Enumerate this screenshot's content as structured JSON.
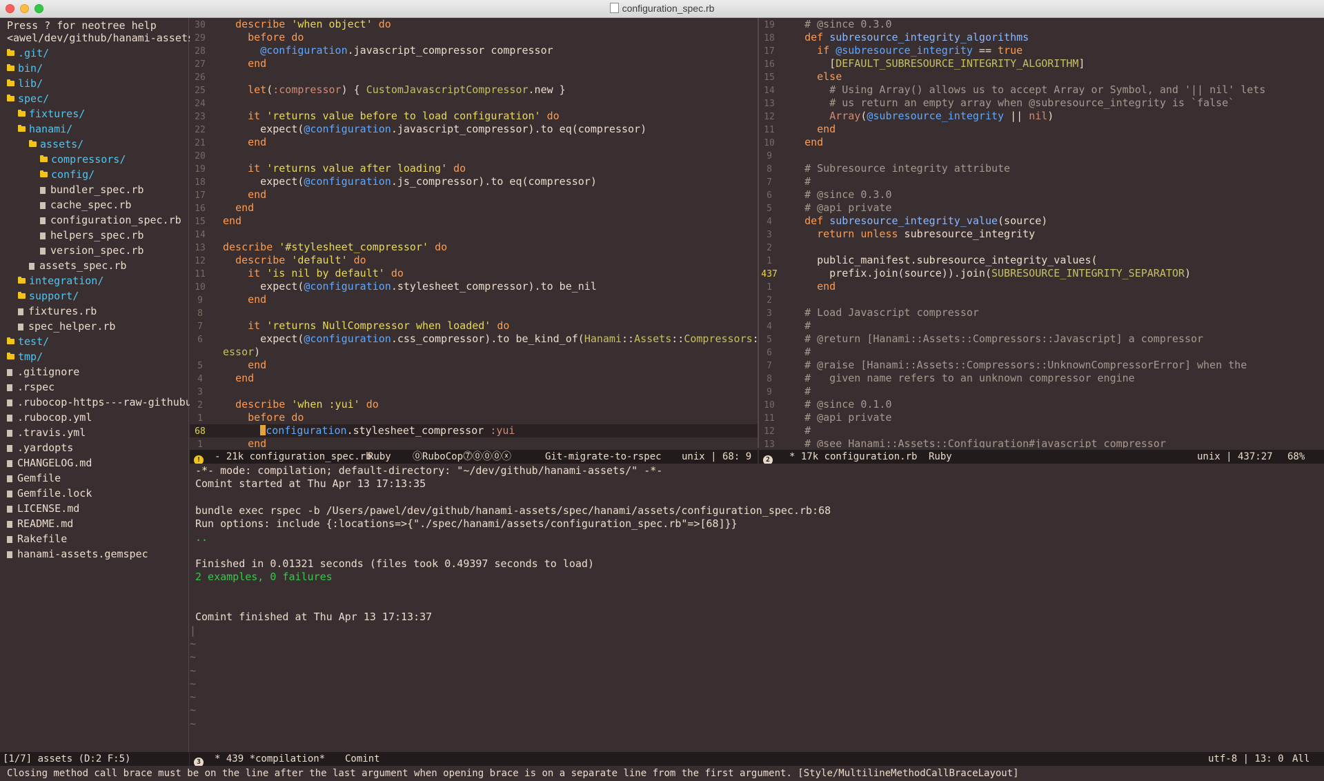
{
  "window": {
    "title": "configuration_spec.rb"
  },
  "tree": {
    "help": "Press ? for neotree help",
    "path": "<awel/dev/github/hanami-assets/",
    "items": [
      {
        "label": ".git/",
        "kind": "dir",
        "depth": 0
      },
      {
        "label": "bin/",
        "kind": "dir",
        "depth": 0
      },
      {
        "label": "lib/",
        "kind": "dir",
        "depth": 0
      },
      {
        "label": "spec/",
        "kind": "dir",
        "depth": 0
      },
      {
        "label": "fixtures/",
        "kind": "dir",
        "depth": 1
      },
      {
        "label": "hanami/",
        "kind": "dir",
        "depth": 1
      },
      {
        "label": "assets/",
        "kind": "dir",
        "depth": 2
      },
      {
        "label": "compressors/",
        "kind": "dir",
        "depth": 3
      },
      {
        "label": "config/",
        "kind": "dir",
        "depth": 3
      },
      {
        "label": "bundler_spec.rb",
        "kind": "file",
        "depth": 3
      },
      {
        "label": "cache_spec.rb",
        "kind": "file",
        "depth": 3
      },
      {
        "label": "configuration_spec.rb",
        "kind": "file",
        "depth": 3
      },
      {
        "label": "helpers_spec.rb",
        "kind": "file",
        "depth": 3
      },
      {
        "label": "version_spec.rb",
        "kind": "file",
        "depth": 3
      },
      {
        "label": "assets_spec.rb",
        "kind": "file",
        "depth": 2
      },
      {
        "label": "integration/",
        "kind": "dir",
        "depth": 1
      },
      {
        "label": "support/",
        "kind": "dir",
        "depth": 1
      },
      {
        "label": "fixtures.rb",
        "kind": "file",
        "depth": 1
      },
      {
        "label": "spec_helper.rb",
        "kind": "file",
        "depth": 1
      },
      {
        "label": "test/",
        "kind": "dir",
        "depth": 0
      },
      {
        "label": "tmp/",
        "kind": "dir",
        "depth": 0
      },
      {
        "label": ".gitignore",
        "kind": "file",
        "depth": 0
      },
      {
        "label": ".rspec",
        "kind": "file",
        "depth": 0
      },
      {
        "label": ".rubocop-https---raw-githubuse>",
        "kind": "file",
        "depth": 0
      },
      {
        "label": ".rubocop.yml",
        "kind": "file",
        "depth": 0
      },
      {
        "label": ".travis.yml",
        "kind": "file",
        "depth": 0
      },
      {
        "label": ".yardopts",
        "kind": "file",
        "depth": 0
      },
      {
        "label": "CHANGELOG.md",
        "kind": "file",
        "depth": 0
      },
      {
        "label": "Gemfile",
        "kind": "file",
        "depth": 0
      },
      {
        "label": "Gemfile.lock",
        "kind": "file",
        "depth": 0
      },
      {
        "label": "LICENSE.md",
        "kind": "file",
        "depth": 0
      },
      {
        "label": "README.md",
        "kind": "file",
        "depth": 0
      },
      {
        "label": "Rakefile",
        "kind": "file",
        "depth": 0
      },
      {
        "label": "hanami-assets.gemspec",
        "kind": "file",
        "depth": 0
      }
    ],
    "modeline": "[1/7] assets (D:2 F:5)"
  },
  "left_editor": {
    "current_line_number": "68",
    "lines": [
      {
        "n": "30",
        "html": "  <span class='kw'>describe</span> <span class='str'>'when object'</span> <span class='kw'>do</span>"
      },
      {
        "n": "29",
        "html": "    <span class='kw'>before</span> <span class='kw'>do</span>"
      },
      {
        "n": "28",
        "html": "      <span class='iv'>@configuration</span>.javascript_compressor compressor"
      },
      {
        "n": "27",
        "html": "    <span class='kw'>end</span>"
      },
      {
        "n": "26",
        "html": ""
      },
      {
        "n": "25",
        "html": "    <span class='kw'>let</span>(<span class='sym'>:compressor</span>) { <span class='cn'>CustomJavascriptCompressor</span>.new }"
      },
      {
        "n": "24",
        "html": ""
      },
      {
        "n": "23",
        "html": "    <span class='kw'>it</span> <span class='str'>'returns value before to load configuration'</span> <span class='kw'>do</span>"
      },
      {
        "n": "22",
        "html": "      expect(<span class='iv'>@configuration</span>.javascript_compressor).to eq(compressor)"
      },
      {
        "n": "21",
        "html": "    <span class='kw'>end</span>"
      },
      {
        "n": "20",
        "html": ""
      },
      {
        "n": "19",
        "html": "    <span class='kw'>it</span> <span class='str'>'returns value after loading'</span> <span class='kw'>do</span>"
      },
      {
        "n": "18",
        "html": "      expect(<span class='iv'>@configuration</span>.js_compressor).to eq(compressor)"
      },
      {
        "n": "17",
        "html": "    <span class='kw'>end</span>"
      },
      {
        "n": "16",
        "html": "  <span class='kw'>end</span>"
      },
      {
        "n": "15",
        "html": "<span class='kw'>end</span>"
      },
      {
        "n": "14",
        "html": ""
      },
      {
        "n": "13",
        "html": "<span class='kw'>describe</span> <span class='str'>'#stylesheet_compressor'</span> <span class='kw'>do</span>"
      },
      {
        "n": "12",
        "html": "  <span class='kw'>describe</span> <span class='str'>'default'</span> <span class='kw'>do</span>"
      },
      {
        "n": "11",
        "html": "    <span class='kw'>it</span> <span class='str'>'is nil by default'</span> <span class='kw'>do</span>"
      },
      {
        "n": "10",
        "html": "      expect(<span class='iv'>@configuration</span>.stylesheet_compressor).to be_nil"
      },
      {
        "n": "9",
        "html": "    <span class='kw'>end</span>"
      },
      {
        "n": "8",
        "html": ""
      },
      {
        "n": "7",
        "html": "    <span class='kw'>it</span> <span class='str'>'returns NullCompressor when loaded'</span> <span class='kw'>do</span>"
      },
      {
        "n": "6",
        "html": "      expect(<span class='iv'>@configuration</span>.css_compressor).to be_kind_of(<span class='cn'>Hanami</span>::<span class='cn'>Assets</span>::<span class='cn'>Compressors</span>::<span class='cn'>NullCompr</span>↪"
      },
      {
        "n": "",
        "html": "<span class='cn'>essor</span>)"
      },
      {
        "n": "5",
        "html": "    <span class='kw'>end</span>"
      },
      {
        "n": "4",
        "html": "  <span class='kw'>end</span>"
      },
      {
        "n": "3",
        "html": ""
      },
      {
        "n": "2",
        "html": "  <span class='kw'>describe</span> <span class='str'>'when :yui'</span> <span class='kw'>do</span>"
      },
      {
        "n": "1",
        "html": "    <span class='kw'>before</span> <span class='kw'>do</span>"
      },
      {
        "n": "68",
        "html": "      <span class='cursor'></span><span class='iv'>configuration</span>.stylesheet_compressor <span class='sym'>:yui</span>",
        "current": true
      },
      {
        "n": "1",
        "html": "    <span class='kw'>end</span>"
      }
    ],
    "modeline": {
      "badge": "!",
      "size_name": "- 21k configuration_spec.rb",
      "mode": "Ruby",
      "rubocop": "⓪RuboCop⓻⓪⓪⓪ⓧ",
      "branch": "Git-migrate-to-rspec",
      "position": "unix | 68: 9"
    }
  },
  "right_editor": {
    "lines": [
      {
        "n": "19",
        "html": "  <span class='cm'># @since 0.3.0</span>"
      },
      {
        "n": "18",
        "html": "  <span class='kw'>def</span> <span class='fn'>subresource_integrity_algorithms</span>"
      },
      {
        "n": "17",
        "html": "    <span class='kw'>if</span> <span class='iv'>@subresource_integrity</span> == <span class='tru'>true</span>"
      },
      {
        "n": "16",
        "html": "      [<span class='cn'>DEFAULT_SUBRESOURCE_INTEGRITY_ALGORITHM</span>]"
      },
      {
        "n": "15",
        "html": "    <span class='kw'>else</span>"
      },
      {
        "n": "14",
        "html": "      <span class='cm'># Using Array() allows us to accept Array or Symbol, and '|| nil' lets</span>"
      },
      {
        "n": "13",
        "html": "      <span class='cm'># us return an empty array when @subresource_integrity is `false`</span>"
      },
      {
        "n": "12",
        "html": "      <span class='sym'>Array</span>(<span class='iv'>@subresource_integrity</span> || <span class='sym'>nil</span>)"
      },
      {
        "n": "11",
        "html": "    <span class='kw'>end</span>"
      },
      {
        "n": "10",
        "html": "  <span class='kw'>end</span>"
      },
      {
        "n": "9",
        "html": ""
      },
      {
        "n": "8",
        "html": "  <span class='cm'># Subresource integrity attribute</span>"
      },
      {
        "n": "7",
        "html": "  <span class='cm'>#</span>"
      },
      {
        "n": "6",
        "html": "  <span class='cm'># @since 0.3.0</span>"
      },
      {
        "n": "5",
        "html": "  <span class='cm'># @api private</span>"
      },
      {
        "n": "4",
        "html": "  <span class='kw'>def</span> <span class='fn'>subresource_integrity_value</span>(source)"
      },
      {
        "n": "3",
        "html": "    <span class='kw'>return unless</span> subresource_integrity"
      },
      {
        "n": "2",
        "html": ""
      },
      {
        "n": "1",
        "html": "    public_manifest.subresource_integrity_values("
      },
      {
        "n": "437",
        "html": "      prefix.join(source)).join(<span class='cn'>SUBRESOURCE_INTEGRITY_SEPARATOR</span>)",
        "mark": true
      },
      {
        "n": "1",
        "html": "    <span class='kw'>end</span>"
      },
      {
        "n": "2",
        "html": ""
      },
      {
        "n": "3",
        "html": "  <span class='cm'># Load Javascript compressor</span>"
      },
      {
        "n": "4",
        "html": "  <span class='cm'>#</span>"
      },
      {
        "n": "5",
        "html": "  <span class='cm'># @return [Hanami::Assets::Compressors::Javascript] a compressor</span>"
      },
      {
        "n": "6",
        "html": "  <span class='cm'>#</span>"
      },
      {
        "n": "7",
        "html": "  <span class='cm'># @raise [Hanami::Assets::Compressors::UnknownCompressorError] when the</span>"
      },
      {
        "n": "8",
        "html": "  <span class='cm'>#   given name refers to an unknown compressor engine</span>"
      },
      {
        "n": "9",
        "html": "  <span class='cm'>#</span>"
      },
      {
        "n": "10",
        "html": "  <span class='cm'># @since 0.1.0</span>"
      },
      {
        "n": "11",
        "html": "  <span class='cm'># @api private</span>"
      },
      {
        "n": "12",
        "html": "  <span class='cm'>#</span>"
      },
      {
        "n": "13",
        "html": "  <span class='cm'># @see Hanami::Assets::Configuration#javascript_compressor</span>"
      }
    ],
    "modeline": {
      "badge": "2",
      "size_name": "* 17k configuration.rb",
      "mode": "Ruby",
      "position": "unix | 437:27",
      "percent": "68%"
    }
  },
  "compilation": {
    "lines": [
      {
        "text": "-*- mode: compilation; default-directory: \"~/dev/github/hanami-assets/\" -*-"
      },
      {
        "text": "Comint started at Thu Apr 13 17:13:35"
      },
      {
        "text": ""
      },
      {
        "text": "bundle exec rspec -b /Users/pawel/dev/github/hanami-assets/spec/hanami/assets/configuration_spec.rb:68"
      },
      {
        "text": "Run options: include {:locations=>{\"./spec/hanami/assets/configuration_spec.rb\"=>[68]}}"
      },
      {
        "text": "..",
        "green": true
      },
      {
        "text": ""
      },
      {
        "text": "Finished in 0.01321 seconds (files took 0.49397 seconds to load)"
      },
      {
        "text": "2 examples, 0 failures",
        "green": true
      },
      {
        "text": ""
      },
      {
        "text": ""
      },
      {
        "text": "Comint finished at Thu Apr 13 17:13:37"
      }
    ],
    "modeline": {
      "badge": "3",
      "name": "* 439 *compilation*",
      "mode": "Comint",
      "encoding": "utf-8 | 13: 0",
      "all": "All"
    }
  },
  "echo_area": "Closing method call brace must be on the line after the last argument when opening brace is on a separate line from the first argument. [Style/MultilineMethodCallBraceLayout]"
}
